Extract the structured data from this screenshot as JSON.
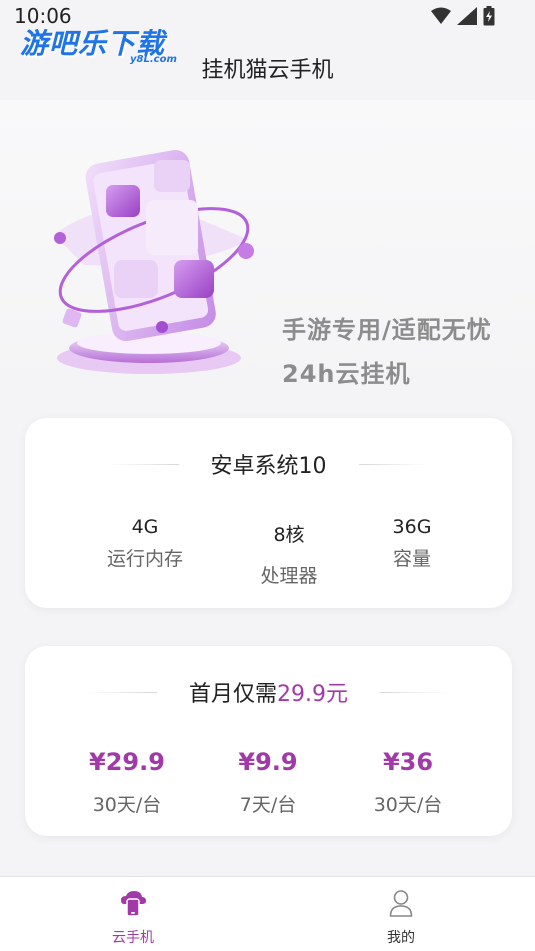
{
  "status_bar": {
    "time": "10:06"
  },
  "watermark": {
    "text": "游吧乐下载",
    "sub": "y8L.com"
  },
  "app": {
    "title": "挂机猫云手机"
  },
  "hero": {
    "line1": "手游专用/适配无忧",
    "line2": "24h云挂机"
  },
  "os_card": {
    "title": "安卓系统10",
    "specs": [
      {
        "value": "4G",
        "label": "运行内存"
      },
      {
        "value": "8核",
        "label": "处理器"
      },
      {
        "value": "36G",
        "label": "容量"
      }
    ]
  },
  "price_card": {
    "title_prefix": "首月仅需",
    "title_price": "29.9元",
    "plans": [
      {
        "price": "¥29.9",
        "term": "30天/台"
      },
      {
        "price": "¥9.9",
        "term": "7天/台"
      },
      {
        "price": "¥36",
        "term": "30天/台"
      }
    ]
  },
  "tabs": [
    {
      "label": "云手机",
      "icon": "cloud-phone-icon",
      "active": true
    },
    {
      "label": "我的",
      "icon": "user-icon",
      "active": false
    }
  ],
  "colors": {
    "accent": "#a13aa8",
    "background": "#f4f4f6",
    "watermark": "#1f74e8"
  }
}
